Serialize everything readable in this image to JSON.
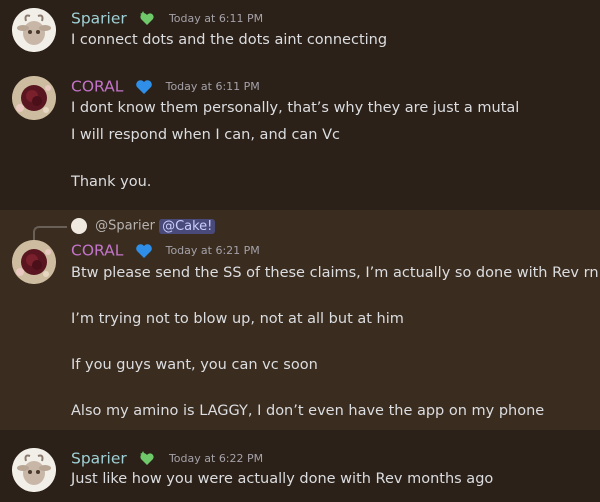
{
  "messages": [
    {
      "author": "Sparier",
      "author_color": "#9fd0d6",
      "badge_icon": "sparkle-heart-icon",
      "timestamp": "Today at 6:11 PM",
      "lines": [
        "I connect dots and the dots aint connecting"
      ]
    },
    {
      "author": "CORAL",
      "author_color": "#c274c8",
      "badge_icon": "blue-heart-icon",
      "timestamp": "Today at 6:11 PM",
      "lines": [
        "I dont know them personally, that’s why they are just a mutal",
        "I will respond when I can, and can Vc",
        "Thank you."
      ]
    },
    {
      "reply_to_user": "@Sparier",
      "reply_mention": "@Cake!",
      "author": "CORAL",
      "author_color": "#c274c8",
      "badge_icon": "blue-heart-icon",
      "timestamp": "Today at 6:21 PM",
      "lines": [
        "Btw please send the SS of these claims, I’m actually so done with Rev rn",
        "I’m trying not to blow up, not at all but at him",
        "If you guys want, you can vc soon",
        "Also my amino is LAGGY, I don’t even have the app on my phone"
      ]
    },
    {
      "author": "Sparier",
      "author_color": "#9fd0d6",
      "badge_icon": "sparkle-heart-icon",
      "timestamp": "Today at 6:22 PM",
      "lines": [
        "Just like how you were actually done with Rev months ago"
      ]
    }
  ]
}
